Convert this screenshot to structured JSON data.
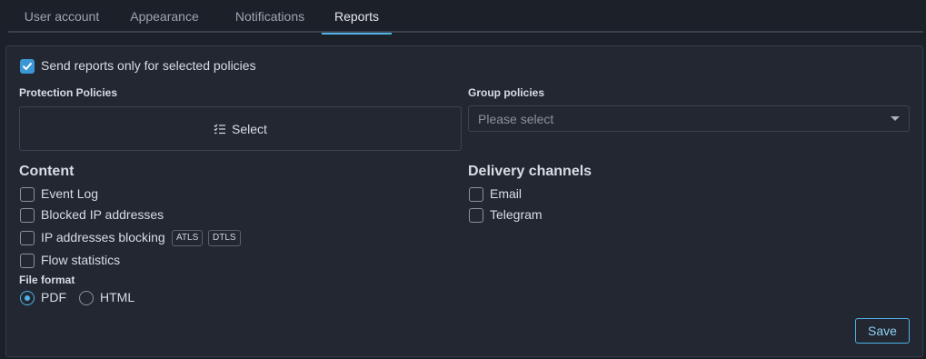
{
  "tabs": [
    {
      "label": "User account"
    },
    {
      "label": "Appearance"
    },
    {
      "label": "Notifications"
    },
    {
      "label": "Reports"
    }
  ],
  "active_tab": "Reports",
  "send_selected": {
    "label": "Send reports only for selected policies",
    "checked": true
  },
  "protection_policies": {
    "title": "Protection Policies",
    "button_label": "Select",
    "icon": "list-check-icon"
  },
  "group_policies": {
    "title": "Group policies",
    "placeholder": "Please select"
  },
  "content": {
    "title": "Content",
    "items": [
      {
        "label": "Event Log",
        "checked": false
      },
      {
        "label": "Blocked IP addresses",
        "checked": false
      },
      {
        "label": "IP addresses blocking",
        "checked": false,
        "badges": [
          "ATLS",
          "DTLS"
        ]
      },
      {
        "label": "Flow statistics",
        "checked": false
      }
    ]
  },
  "delivery": {
    "title": "Delivery channels",
    "items": [
      {
        "label": "Email",
        "checked": false
      },
      {
        "label": "Telegram",
        "checked": false
      }
    ]
  },
  "file_format": {
    "title": "File format",
    "options": [
      {
        "label": "PDF",
        "selected": true
      },
      {
        "label": "HTML",
        "selected": false
      }
    ]
  },
  "save_label": "Save",
  "colors": {
    "accent": "#4fb3e8",
    "background": "#1c2028",
    "panel": "#222731"
  }
}
